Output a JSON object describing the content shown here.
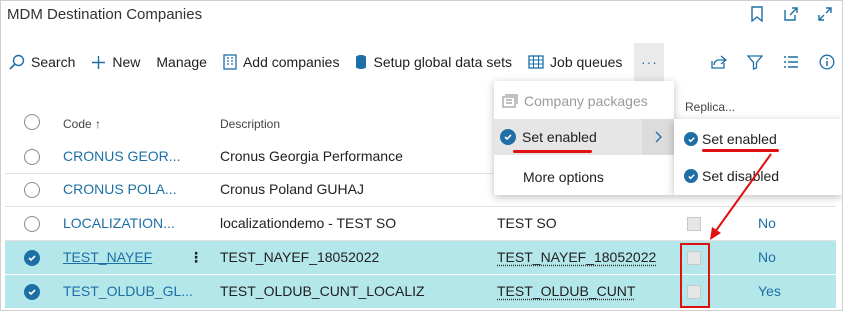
{
  "window": {
    "title": "MDM Destination Companies",
    "icons": [
      "bookmark-icon",
      "open-new-window-icon",
      "expand-icon"
    ]
  },
  "toolbar": {
    "search_label": "Search",
    "new_label": "New",
    "manage_label": "Manage",
    "add_companies_label": "Add companies",
    "setup_global_label": "Setup global data sets",
    "job_queues_label": "Job queues",
    "more_label": "···",
    "right_icons": [
      "share-icon",
      "filter-icon",
      "list-view-icon",
      "info-icon"
    ]
  },
  "table": {
    "headers": {
      "code": "Code ↑",
      "description": "Description",
      "replica": "Replica..."
    },
    "rows": [
      {
        "code": "CRONUS GEOR...",
        "description": "Cronus Georgia Performance",
        "col3": "",
        "replica": "",
        "selected": false
      },
      {
        "code": "CRONUS POLA...",
        "description": "Cronus Poland GUHAJ",
        "col3": "",
        "replica": "",
        "selected": false
      },
      {
        "code": "LOCALIZATION...",
        "description": "localizationdemo - TEST SO",
        "col3": "TEST SO",
        "replica": "No",
        "selected": false
      },
      {
        "code": "TEST_NAYEF",
        "description": "TEST_NAYEF_18052022",
        "col3": "TEST_NAYEF_18052022",
        "replica": "No",
        "selected": true
      },
      {
        "code": "TEST_OLDUB_GL...",
        "description": "TEST_OLDUB_CUNT_LOCALIZ",
        "col3": "TEST_OLDUB_CUNT",
        "replica": "Yes",
        "selected": true
      }
    ]
  },
  "menu": {
    "company_packages": "Company packages",
    "set_enabled": "Set enabled",
    "more_options": "More options"
  },
  "submenu": {
    "set_enabled": "Set enabled",
    "set_disabled": "Set disabled"
  },
  "colors": {
    "accent": "#1d6fa5",
    "selected_row": "#b4e7ea",
    "annotation": "#e01010"
  }
}
